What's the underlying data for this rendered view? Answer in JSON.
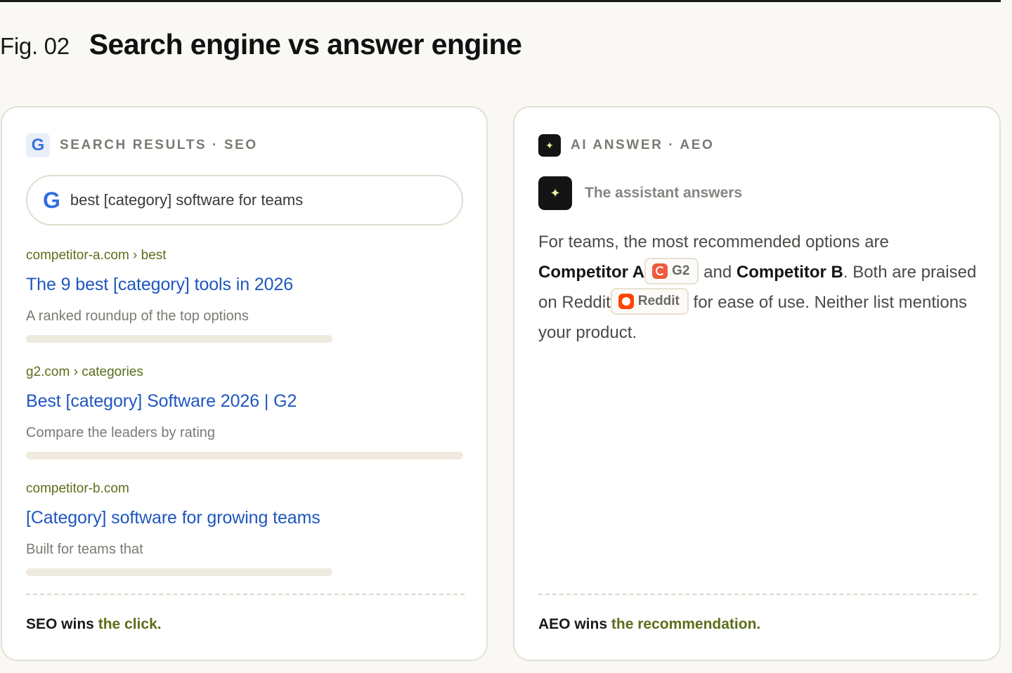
{
  "figure": {
    "label": "Fig. 02",
    "title": "Search engine vs answer engine"
  },
  "seo": {
    "eyebrow": "SEARCH RESULTS · SEO",
    "icon": "google-g-icon",
    "badge_glyph": "G",
    "search_query": "best [category] software for teams",
    "results": [
      {
        "url": "competitor-a.com › best",
        "title": "The 9 best [category] tools in 2026",
        "description": "A ranked roundup of the top options"
      },
      {
        "url": "g2.com › categories",
        "title": "Best [category] Software 2026 | G2",
        "description": "Compare the leaders by rating"
      },
      {
        "url": "competitor-b.com",
        "title": "[Category] software for growing teams",
        "description": "Built for teams that"
      }
    ],
    "verdict_lead": "SEO wins",
    "verdict_accent": "the click."
  },
  "aeo": {
    "eyebrow": "AI ANSWER · AEO",
    "icon": "sparkle-icon",
    "sparkle_glyph": "✦",
    "assistant_label": "The assistant answers",
    "answer": {
      "part1": "For teams, the most recommended options are ",
      "competitor_a": "Competitor A",
      "chip_g2": "G2",
      "part2": " and ",
      "competitor_b": "Competitor B",
      "part3": ". Both are praised on Reddit",
      "chip_reddit": "Reddit",
      "part4": " for ease of use. Neither list mentions your product."
    },
    "verdict_lead": "AEO wins",
    "verdict_accent": "the recommendation."
  },
  "colors": {
    "background": "#f9f8f4",
    "link_blue": "#1f56c0",
    "url_green": "#5a6e1a",
    "accent_green": "#5a6e1a",
    "g2_red": "#f05a3c",
    "reddit_orange": "#ff4500"
  }
}
